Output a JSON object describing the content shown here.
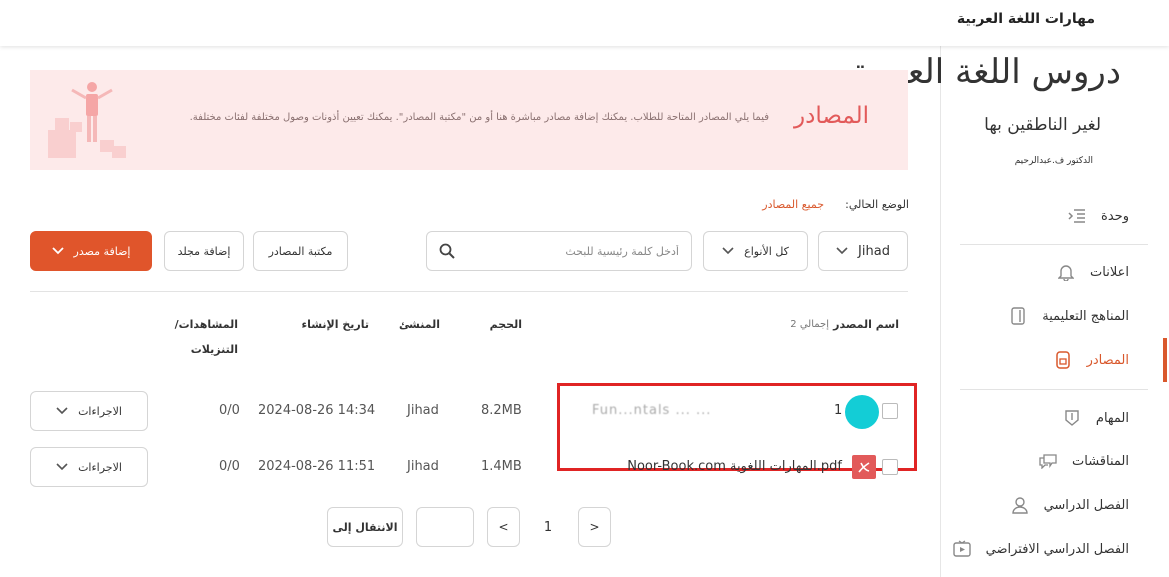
{
  "header": {
    "course_title": "مهارات اللغة العربية"
  },
  "logo": {
    "main": "دروس اللغة العربية",
    "sub": "لغير الناطقين بها",
    "author": "الدكتور ف.عبدالرحيم"
  },
  "sidebar": {
    "items": [
      {
        "label": "وحدة",
        "icon": "list-indent-icon",
        "active": false
      },
      {
        "label": "اعلانات",
        "icon": "bell-icon",
        "active": false
      },
      {
        "label": "المناهج التعليمية",
        "icon": "book-icon",
        "active": false
      },
      {
        "label": "المصادر",
        "icon": "resources-icon",
        "active": true
      },
      {
        "label": "المهام",
        "icon": "shield-icon",
        "active": false
      },
      {
        "label": "المناقشات",
        "icon": "chat-icon",
        "active": false
      },
      {
        "label": "الفصل الدراسي",
        "icon": "user-icon",
        "active": false
      },
      {
        "label": "الفصل الدراسي الافتراضي",
        "icon": "video-icon",
        "active": false
      }
    ]
  },
  "banner": {
    "title": "المصادر",
    "description": "فيما يلي المصادر المتاحة للطلاب. يمكنك إضافة مصادر مباشرة هنا أو من \"مكتبة المصادر\". يمكنك تعيين أذونات وصول مختلفة لفئات مختلفة."
  },
  "breadcrumb": {
    "label": "الوضع الحالي:",
    "separator": ":",
    "current": "جميع المصادر"
  },
  "toolbar": {
    "owner_filter": "Jihad",
    "type_filter": "كل الأنواع",
    "search_placeholder": "أدخل كلمة رئيسية للبحث",
    "library_button": "مكتبة المصادر",
    "add_folder_button": "إضافة مجلد",
    "add_resource_button": "إضافة مصدر"
  },
  "table": {
    "headers": {
      "name": "اسم المصدر",
      "total": "إجمالي 2",
      "size": "الحجم",
      "creator": "المنشئ",
      "created": "تاريخ الإنشاء",
      "views_line1": "المشاهدات/",
      "views_line2": "التنزيلات"
    },
    "rows": [
      {
        "name": "Fun...ntals ... ...",
        "prefix": "1",
        "size": "8.2MB",
        "creator": "Jihad",
        "created": "2024-08-26 14:34",
        "views": "0/0",
        "action": "الاجراءات"
      },
      {
        "name": "Noor-Book.com  المهارات اللغوية.pdf",
        "prefix": "",
        "size": "1.4MB",
        "creator": "Jihad",
        "created": "2024-08-26 11:51",
        "views": "0/0",
        "action": "الاجراءات",
        "file_type": "pdf"
      }
    ]
  },
  "pagination": {
    "current_page": "1",
    "prev": "<",
    "next": ">",
    "goto_label": "الانتقال إلى",
    "goto_value": ""
  },
  "colors": {
    "accent": "#e0552b",
    "highlight": "#e02424",
    "banner_bg": "#fdeaea"
  }
}
